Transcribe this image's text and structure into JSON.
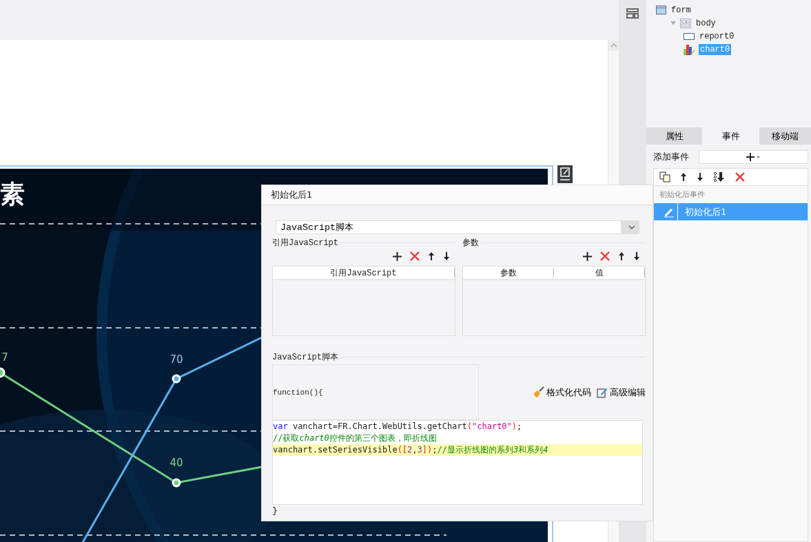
{
  "canvas": {
    "chart": {
      "title": "素",
      "point_labels": [
        {
          "text": "7",
          "color": "#7ed58a"
        },
        {
          "text": "70",
          "color": "#8fc6f0"
        },
        {
          "text": "40",
          "color": "#7ed58a"
        }
      ]
    }
  },
  "right_panel": {
    "tree": [
      {
        "label": "form",
        "kind": "form",
        "selected": false,
        "children": [
          {
            "label": "body",
            "kind": "layout",
            "selected": false,
            "expanded": true,
            "children": [
              {
                "label": "report0",
                "kind": "report",
                "selected": false
              },
              {
                "label": "chart0",
                "kind": "chart",
                "selected": true
              }
            ]
          }
        ]
      }
    ],
    "tabs": [
      {
        "label": "属性",
        "selected": false
      },
      {
        "label": "事件",
        "selected": true
      },
      {
        "label": "移动端",
        "selected": false
      }
    ],
    "add_event_label": "添加事件",
    "event_group": "初始化后事件",
    "events": [
      {
        "label": "初始化后1",
        "selected": true
      }
    ]
  },
  "dialog": {
    "title": "初始化后1",
    "type_select": "JavaScript脚本",
    "ref_section": {
      "title": "引用JavaScript",
      "columns": [
        "引用JavaScript"
      ]
    },
    "param_section": {
      "title": "参数",
      "columns": [
        "参数",
        "值"
      ]
    },
    "script_section": {
      "title": "JavaScript脚本",
      "function_header": "function(){",
      "actions": [
        {
          "label": "格式化代码",
          "kind": "format"
        },
        {
          "label": "高级编辑",
          "kind": "edit"
        }
      ],
      "code_lines": [
        {
          "highlighted": false,
          "tokens": [
            {
              "kind": "keyword",
              "text": "var"
            },
            {
              "kind": "plain",
              "text": " vanchart=FR.Chart.WebUtils.getChart"
            },
            {
              "kind": "bracket",
              "text": "("
            },
            {
              "kind": "string",
              "text": "\"chart0\""
            },
            {
              "kind": "bracket",
              "text": ")"
            },
            {
              "kind": "plain",
              "text": ";"
            }
          ]
        },
        {
          "highlighted": false,
          "tokens": [
            {
              "kind": "comment",
              "text": "//获取"
            },
            {
              "kind": "comment_em",
              "text": "chart0"
            },
            {
              "kind": "comment",
              "text": "控件的第三个图表，即折线图"
            }
          ]
        },
        {
          "highlighted": true,
          "tokens": [
            {
              "kind": "plain",
              "text": "vanchart.setSeriesVisible"
            },
            {
              "kind": "bracket",
              "text": "(["
            },
            {
              "kind": "number",
              "text": "2"
            },
            {
              "kind": "plain",
              "text": ","
            },
            {
              "kind": "number",
              "text": "3"
            },
            {
              "kind": "bracket",
              "text": "])"
            },
            {
              "kind": "plain",
              "text": ";"
            },
            {
              "kind": "comment",
              "text": "//显示折线图的系列"
            },
            {
              "kind": "comment_em",
              "text": "3"
            },
            {
              "kind": "comment",
              "text": "和系列"
            },
            {
              "kind": "comment_em",
              "text": "4"
            }
          ]
        }
      ],
      "closing": "}"
    }
  }
}
